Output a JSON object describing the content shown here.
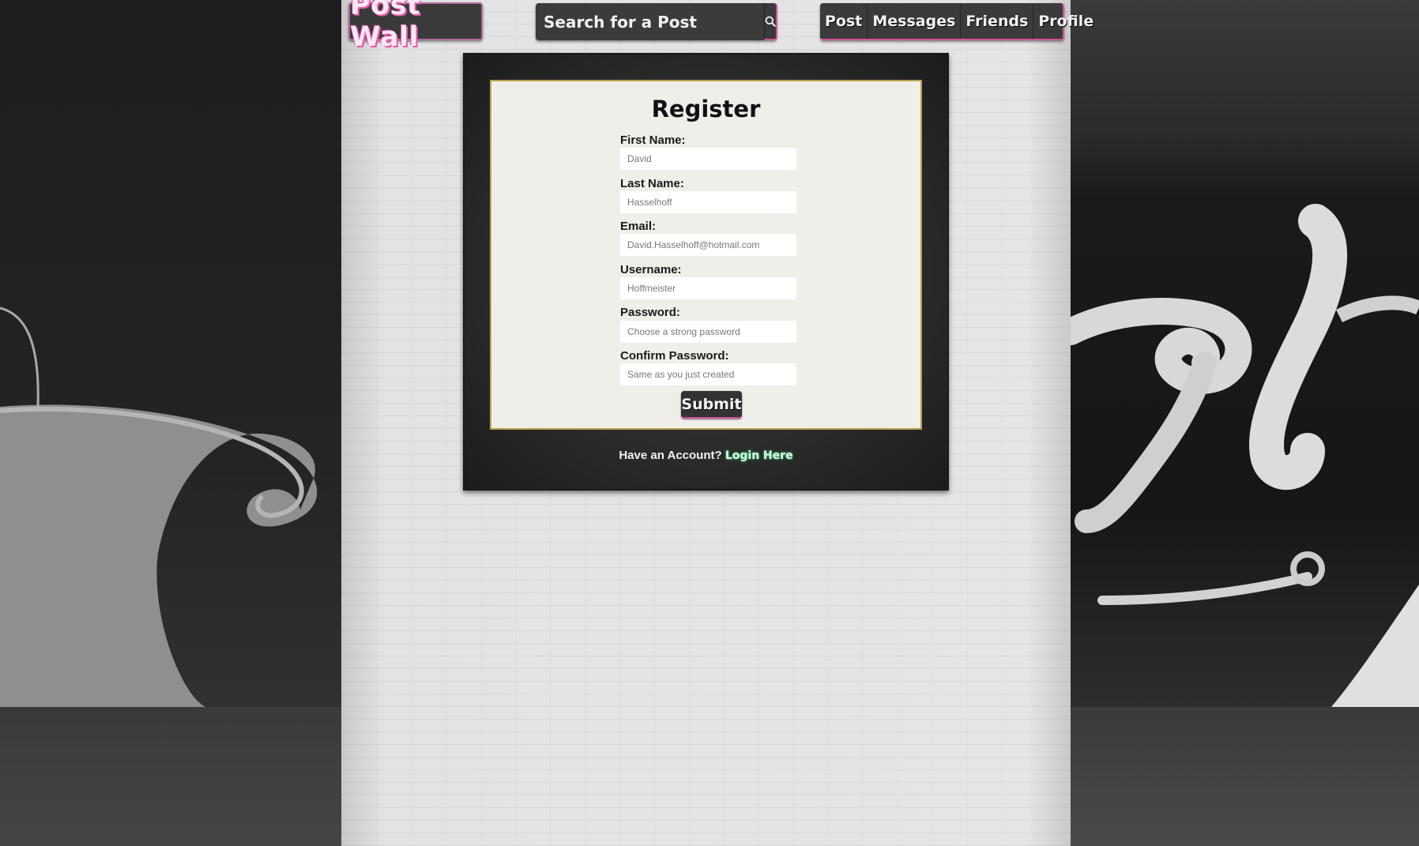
{
  "header": {
    "logo_text": "Post Wall",
    "search": {
      "placeholder": "Search for a Post",
      "button_icon": "search-icon"
    },
    "nav": [
      {
        "label": "Post"
      },
      {
        "label": "Messages"
      },
      {
        "label": "Friends"
      },
      {
        "label": "Profile"
      }
    ]
  },
  "form": {
    "title": "Register",
    "fields": [
      {
        "label": "First Name:",
        "placeholder": "David"
      },
      {
        "label": "Last Name:",
        "placeholder": "Hasselhoff"
      },
      {
        "label": "Email:",
        "placeholder": "David.Hasselhoff@hotmail.com"
      },
      {
        "label": "Username:",
        "placeholder": "Hoffmeister"
      },
      {
        "label": "Password:",
        "placeholder": "Choose a strong password"
      },
      {
        "label": "Confirm Password:",
        "placeholder": "Same as you just created"
      }
    ],
    "submit_label": "Submit",
    "footer_text": "Have an Account?",
    "login_link": "Login Here"
  },
  "colors": {
    "accent_pink": "#d2529b",
    "link_glow": "#2fb36a",
    "bar_bg": "#3b3b3b"
  }
}
